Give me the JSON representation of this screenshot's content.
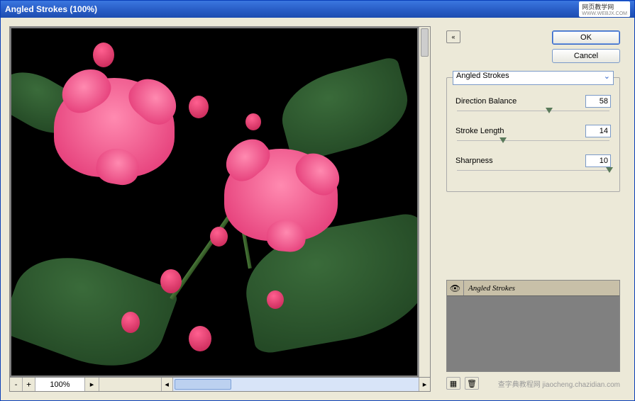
{
  "window": {
    "title": "Angled Strokes (100%)"
  },
  "badge": {
    "text": "网页教学网",
    "sub": "WWW.WEBJX.COM"
  },
  "buttons": {
    "ok": "OK",
    "cancel": "Cancel"
  },
  "filter": {
    "selected": "Angled Strokes",
    "params": [
      {
        "label": "Direction Balance",
        "value": "58",
        "pos": 58
      },
      {
        "label": "Stroke Length",
        "value": "14",
        "pos": 28
      },
      {
        "label": "Sharpness",
        "value": "10",
        "pos": 100
      }
    ]
  },
  "layers": [
    {
      "name": "Angled Strokes",
      "visible": true
    }
  ],
  "zoom": {
    "percent": "100%"
  },
  "watermark": "查字典教程网 jiaocheng.chazidian.com"
}
